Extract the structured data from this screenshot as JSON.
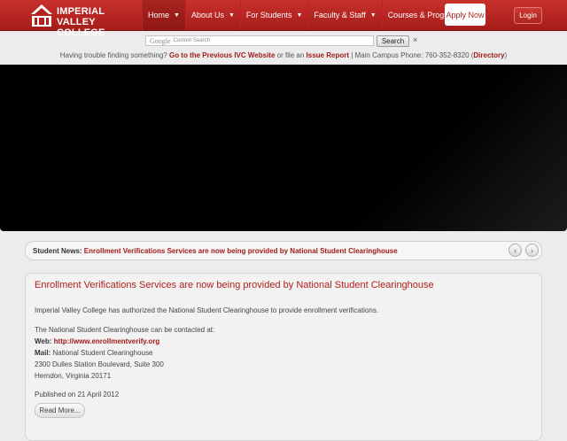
{
  "header": {
    "logo": {
      "line1": "Imperial",
      "line2": "Valley College"
    },
    "nav": [
      {
        "label": "Home",
        "active": true
      },
      {
        "label": "About Us"
      },
      {
        "label": "For Students"
      },
      {
        "label": "Faculty & Staff"
      },
      {
        "label": "Courses & Programs"
      }
    ],
    "apply_label": "Apply Now",
    "login_label": "Login"
  },
  "search": {
    "google_label": "Google",
    "placeholder": "Custom Search",
    "button_label": "Search",
    "clear_label": "×"
  },
  "help": {
    "prefix": "Having trouble finding something? ",
    "link1": "Go to the Previous IVC Website",
    "middle": " or file an ",
    "link2": "Issue Report",
    "phone_text": " | Main Campus Phone: 760-352-8320 (",
    "link3": "Directory",
    "suffix": ")"
  },
  "ticker": {
    "label": "Student News:",
    "headline": "Enrollment Verifications Services are now being provided by National Student Clearinghouse",
    "prev_icon": "‹",
    "next_icon": "›"
  },
  "article": {
    "title": "Enrollment Verifications Services are now being provided by National Student Clearinghouse",
    "intro": "Imperial Valley College has authorized the National Student Clearinghouse to provide enrollment verifications.",
    "contact_intro": "The National Student Clearinghouse can be contacted at:",
    "web_label": "Web:",
    "web_url": "http://www.enrollmentverify.org",
    "mail_label": "Mail:",
    "mail_line1": "National Student Clearinghouse",
    "mail_line2": "2300 Dulles Station Boulevard, Suite 300",
    "mail_line3": "Herndon, Virginia 20171",
    "published": "Published on 21 April 2012",
    "read_more": "Read More..."
  },
  "colors": {
    "brand_red": "#b0201c",
    "link_red": "#a11b17"
  }
}
